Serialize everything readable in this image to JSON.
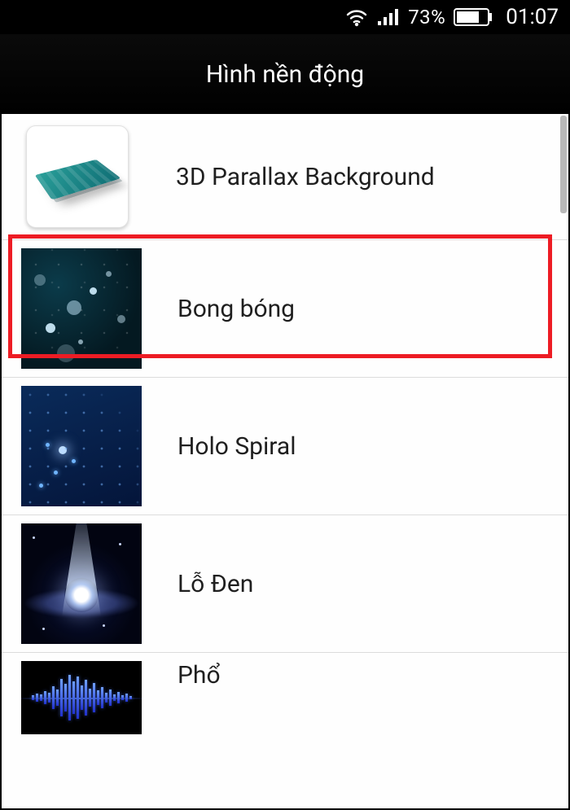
{
  "status_bar": {
    "battery_percent": "73%",
    "clock": "01:07"
  },
  "header": {
    "title": "Hình nền động"
  },
  "wallpapers": [
    {
      "label": "3D Parallax Background",
      "highlighted": true
    },
    {
      "label": "Bong bóng"
    },
    {
      "label": "Holo Spiral"
    },
    {
      "label": "Lỗ Đen"
    },
    {
      "label": "Phổ"
    }
  ]
}
